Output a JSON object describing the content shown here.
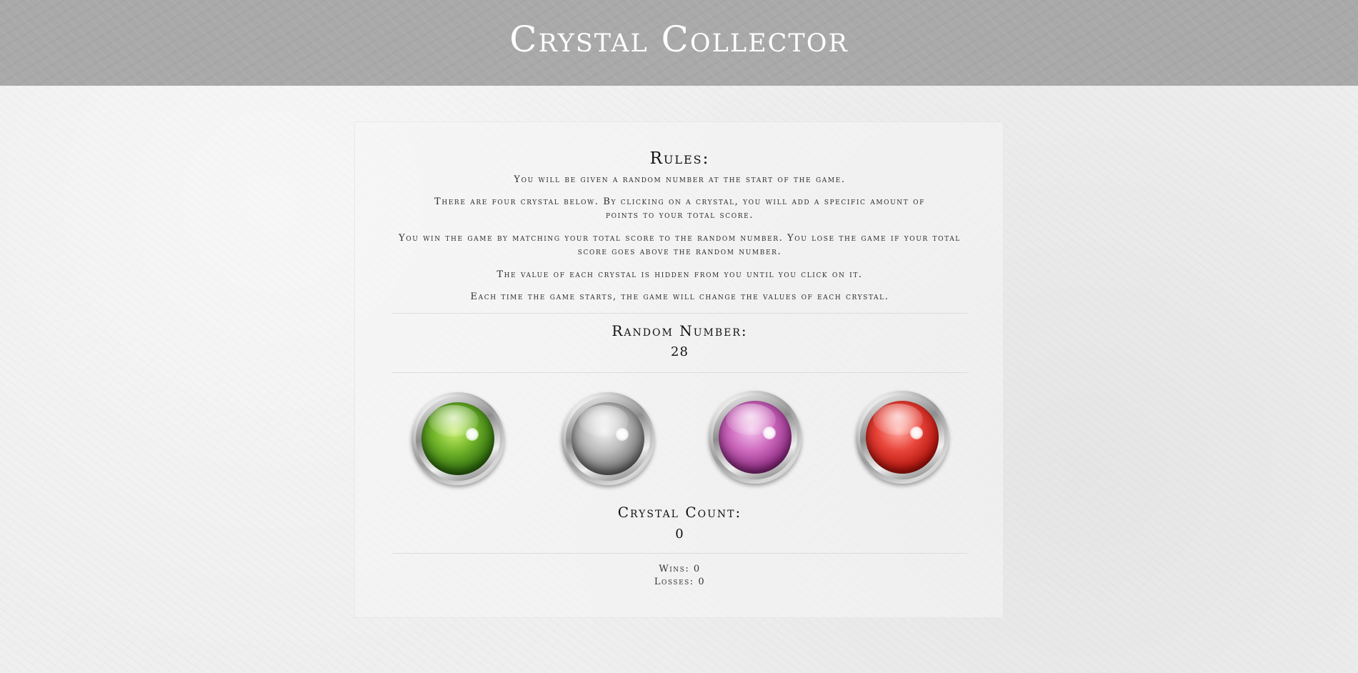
{
  "header": {
    "title": "Crystal Collector"
  },
  "rules": {
    "title": "Rules:",
    "lines": [
      "You will be given a random number at the start of the game.",
      "There are four crystal below. By clicking on a crystal, you will add a specific amount of points to your total score.",
      "You win the game by matching your total score to the random number. You lose the game if your total score goes above the random number.",
      "The value of each crystal is hidden from you until you click on it.",
      "Each time the game starts, the game will change the values of each crystal."
    ]
  },
  "random_number": {
    "label": "Random Number:",
    "value": "28"
  },
  "crystals": [
    {
      "icon": "green-crystal-icon",
      "color": "#72b52a"
    },
    {
      "icon": "silver-crystal-icon",
      "color": "#bdbdbd"
    },
    {
      "icon": "purple-crystal-icon",
      "color": "#cf6cc0"
    },
    {
      "icon": "red-crystal-icon",
      "color": "#e9463b"
    }
  ],
  "crystal_count": {
    "label": "Crystal Count:",
    "value": "0"
  },
  "stats": {
    "wins": "Wins: 0",
    "losses": "Losses: 0"
  }
}
